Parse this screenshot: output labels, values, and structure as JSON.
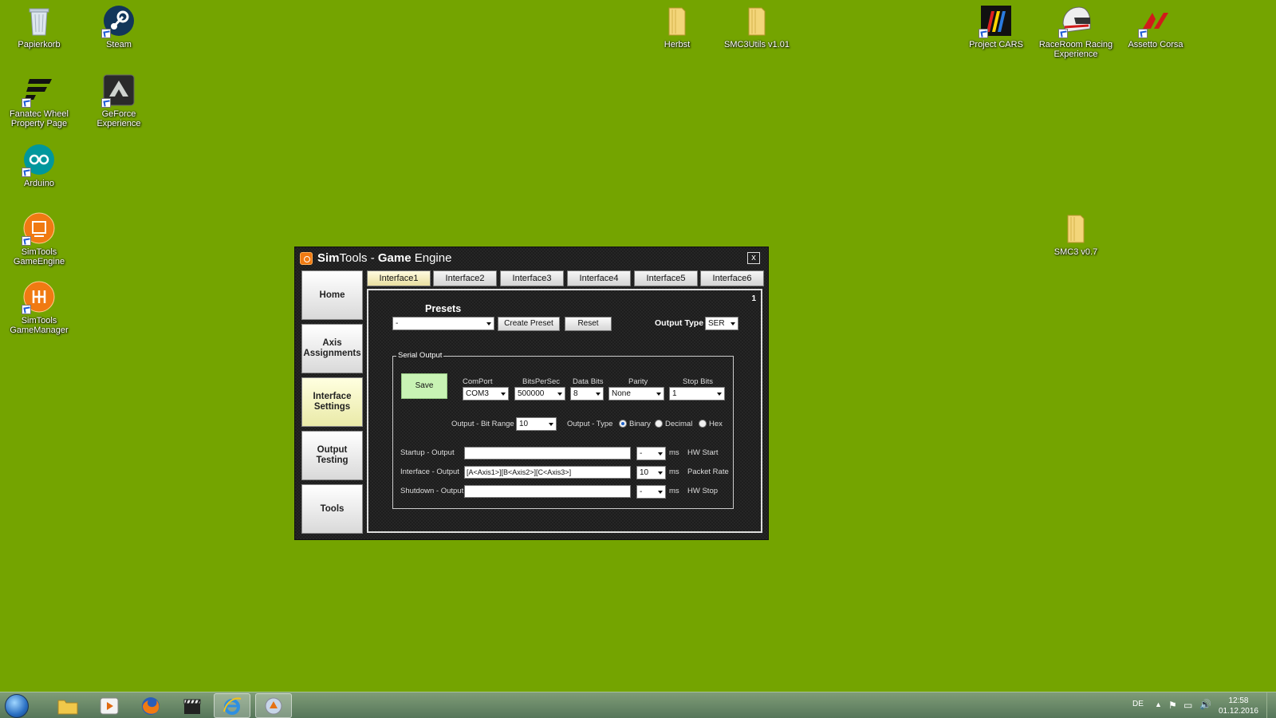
{
  "desktop": {
    "icons": [
      {
        "label": "Papierkorb"
      },
      {
        "label": "Steam"
      },
      {
        "label": "Fanatec Wheel Property Page"
      },
      {
        "label": "GeForce Experience"
      },
      {
        "label": "Arduino"
      },
      {
        "label": "SimTools GameEngine"
      },
      {
        "label": "SimTools GameManager"
      },
      {
        "label": "Herbst"
      },
      {
        "label": "SMC3Utils v1.01"
      },
      {
        "label": "Project CARS"
      },
      {
        "label": "RaceRoom Racing Experience"
      },
      {
        "label": "Assetto Corsa"
      },
      {
        "label": "SMC3 v0.7"
      }
    ]
  },
  "window": {
    "title_sim": "Sim",
    "title_tools": "Tools - ",
    "title_game": "Game",
    "title_engine": " Engine",
    "close": "x"
  },
  "sidebar": {
    "items": [
      {
        "label": "Home"
      },
      {
        "label": "Axis Assignments"
      },
      {
        "label": "Interface Settings"
      },
      {
        "label": "Output Testing"
      },
      {
        "label": "Tools"
      }
    ]
  },
  "tabs": [
    "Interface1",
    "Interface2",
    "Interface3",
    "Interface4",
    "Interface5",
    "Interface6"
  ],
  "panel": {
    "index": "1",
    "presets_label": "Presets",
    "preset_value": "-",
    "create_preset": "Create Preset",
    "reset": "Reset",
    "output_type_label": "Output Type",
    "output_type_value": "SER"
  },
  "serial": {
    "group_title": "Serial Output",
    "save": "Save",
    "comport_label": "ComPort",
    "comport_value": "COM3",
    "bps_label": "BitsPerSec",
    "bps_value": "500000",
    "databits_label": "Data Bits",
    "databits_value": "8",
    "parity_label": "Parity",
    "parity_value": "None",
    "stopbits_label": "Stop Bits",
    "stopbits_value": "1",
    "bitrange_label": "Output - Bit Range",
    "bitrange_value": "10",
    "outtype_label": "Output - Type",
    "binary": "Binary",
    "decimal": "Decimal",
    "hex": "Hex",
    "startup_label": "Startup - Output",
    "startup_value": "",
    "startup_ms": "-",
    "ms": "ms",
    "hw_start": "HW Start",
    "interface_label": "Interface - Output",
    "interface_value": "[A<Axis1>][B<Axis2>][C<Axis3>]",
    "interface_ms": "10",
    "packet_rate": "Packet Rate",
    "shutdown_label": "Shutdown - Output",
    "shutdown_value": "",
    "shutdown_ms": "-",
    "hw_stop": "HW Stop"
  },
  "taskbar": {
    "lang": "DE",
    "time": "12:58",
    "date": "01.12.2016"
  }
}
